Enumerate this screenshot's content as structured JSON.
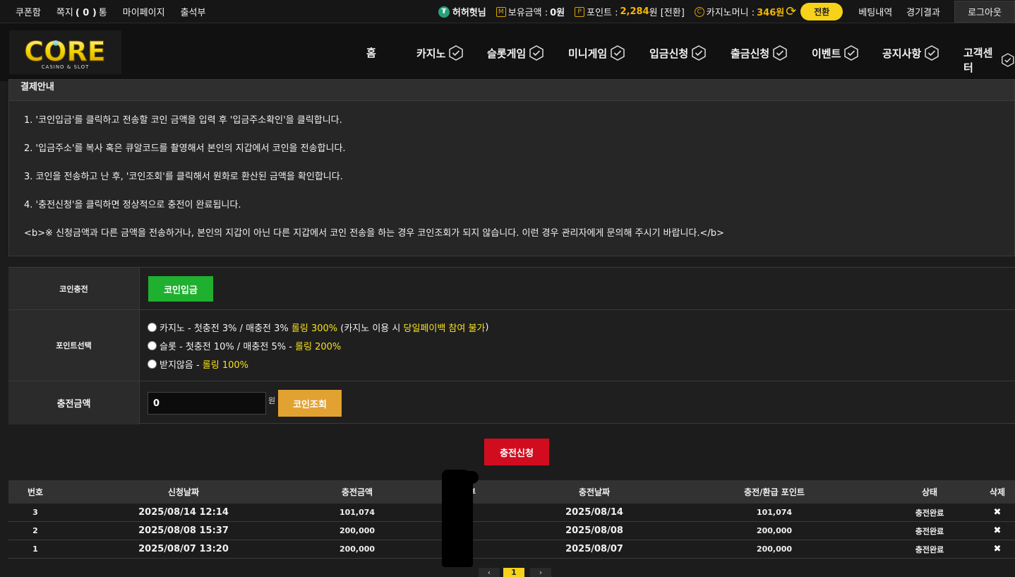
{
  "topbar": {
    "links": [
      "쿠폰함",
      "쪽지",
      "마이페이지",
      "출석부"
    ],
    "message_count": "( 0 )",
    "message_unit": "통",
    "username": "허허헛님",
    "balance_label": "보유금액 :",
    "balance_value": "0원",
    "point_label": "포인트 :",
    "point_value": "2,284",
    "point_suffix": "원 [전환]",
    "casino_label": "카지노머니 :",
    "casino_value": "346원",
    "convert_label": "전환",
    "betting_history": "베팅내역",
    "game_results": "경기결과",
    "logout_label": "로그아웃"
  },
  "logo": {
    "text": "CORE",
    "sub": "CASINO & SLOT"
  },
  "nav": [
    "홈",
    "카지노",
    "슬롯게임",
    "미니게임",
    "입금신청",
    "출금신청",
    "이벤트",
    "공지사항",
    "고객센터"
  ],
  "info": {
    "title": "결제안내",
    "lines": [
      "1. '코인입금'를 클릭하고 전송할 코인 금액을 입력 후 '입금주소확인'을 클릭합니다.",
      "2. '입금주소'를 복사 혹은 큐알코드를 촬영해서 본인의 지갑에서 코인을 전송합니다.",
      "3. 코인을 전송하고 난 후, '코인조회'를 클릭해서 원화로 환산된 금액을 확인합니다.",
      "4. '충전신청'을 클릭하면 정상적으로 충전이 완료됩니다.",
      "<b>※ 신청금액과 다른 금액을 전송하거나, 본인의 지갑이 아닌 다른 지갑에서 코인 전송을 하는 경우 코인조회가 되지 않습니다. 이런 경우 관리자에게 문의해 주시기 바랍니다.</b>"
    ]
  },
  "form": {
    "coin_charge_label": "코인충전",
    "coin_deposit_button": "코인입금",
    "point_select_label": "포인트선택",
    "options": [
      {
        "pre": "카지노 - 첫충전 3% / 매충전 3% ",
        "hl": "롤링 300%",
        "post": " (카지노 이용 시 ",
        "hl2": "당일페이백 참여 불가",
        "post2": ")"
      },
      {
        "pre": "슬롯 - 첫충전 10% / 매충전 5% - ",
        "hl": "롤링 200%",
        "post": "",
        "hl2": "",
        "post2": ""
      },
      {
        "pre": "받지않음 - ",
        "hl": "롤링 100%",
        "post": "",
        "hl2": "",
        "post2": ""
      }
    ],
    "amount_label": "충전금액",
    "amount_value": "0",
    "amount_unit": "원",
    "coin_check_button": "코인조회"
  },
  "submit_label": "충전신청",
  "table": {
    "headers": [
      "번호",
      "신청날짜",
      "충전금액",
      "입금여부",
      "충전날짜",
      "충전/환급 포인트",
      "상태",
      "삭제"
    ],
    "rows": [
      {
        "no": "3",
        "req_date": "2025/08/14 12:14",
        "amount": "101,074",
        "charge_date": "2025/08/14",
        "points": "101,074",
        "status": "충전완료",
        "del": "✖"
      },
      {
        "no": "2",
        "req_date": "2025/08/08 15:37",
        "amount": "200,000",
        "charge_date": "2025/08/08",
        "points": "200,000",
        "status": "충전완료",
        "del": "✖"
      },
      {
        "no": "1",
        "req_date": "2025/08/07 13:20",
        "amount": "200,000",
        "charge_date": "2025/08/07",
        "points": "200,000",
        "status": "충전완료",
        "del": "✖"
      }
    ]
  },
  "pager": {
    "prev": "‹",
    "current": "1",
    "next": "›"
  }
}
